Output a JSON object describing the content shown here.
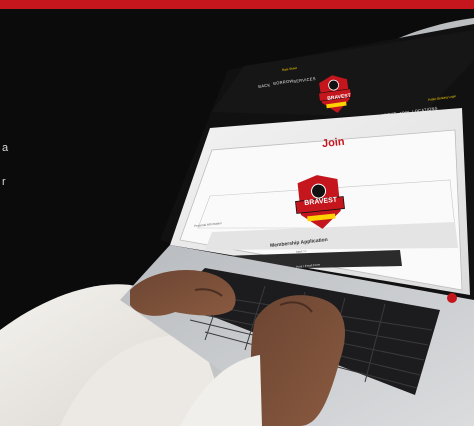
{
  "nav": {
    "left_items": [
      "BACK",
      "BORROW",
      "SERVICES"
    ],
    "right_items": [
      "ABOUT",
      "JOIN",
      "LOCATIONS"
    ],
    "top_promo": "Rate Sheet",
    "login_link": "Public Banking Login"
  },
  "logo": {
    "wordmark": "BRAVEST"
  },
  "page": {
    "title": "Join",
    "form_title": "Membership Application",
    "form_field_label": "Personal Information",
    "form_next_button": "Next >>",
    "footer_button": "Print / Email Form"
  },
  "left_text_fragments": [
    "a",
    "r"
  ],
  "colors": {
    "brand_red": "#c4161c",
    "dark_bg": "#0b0b0c",
    "gold": "#ffd200"
  }
}
